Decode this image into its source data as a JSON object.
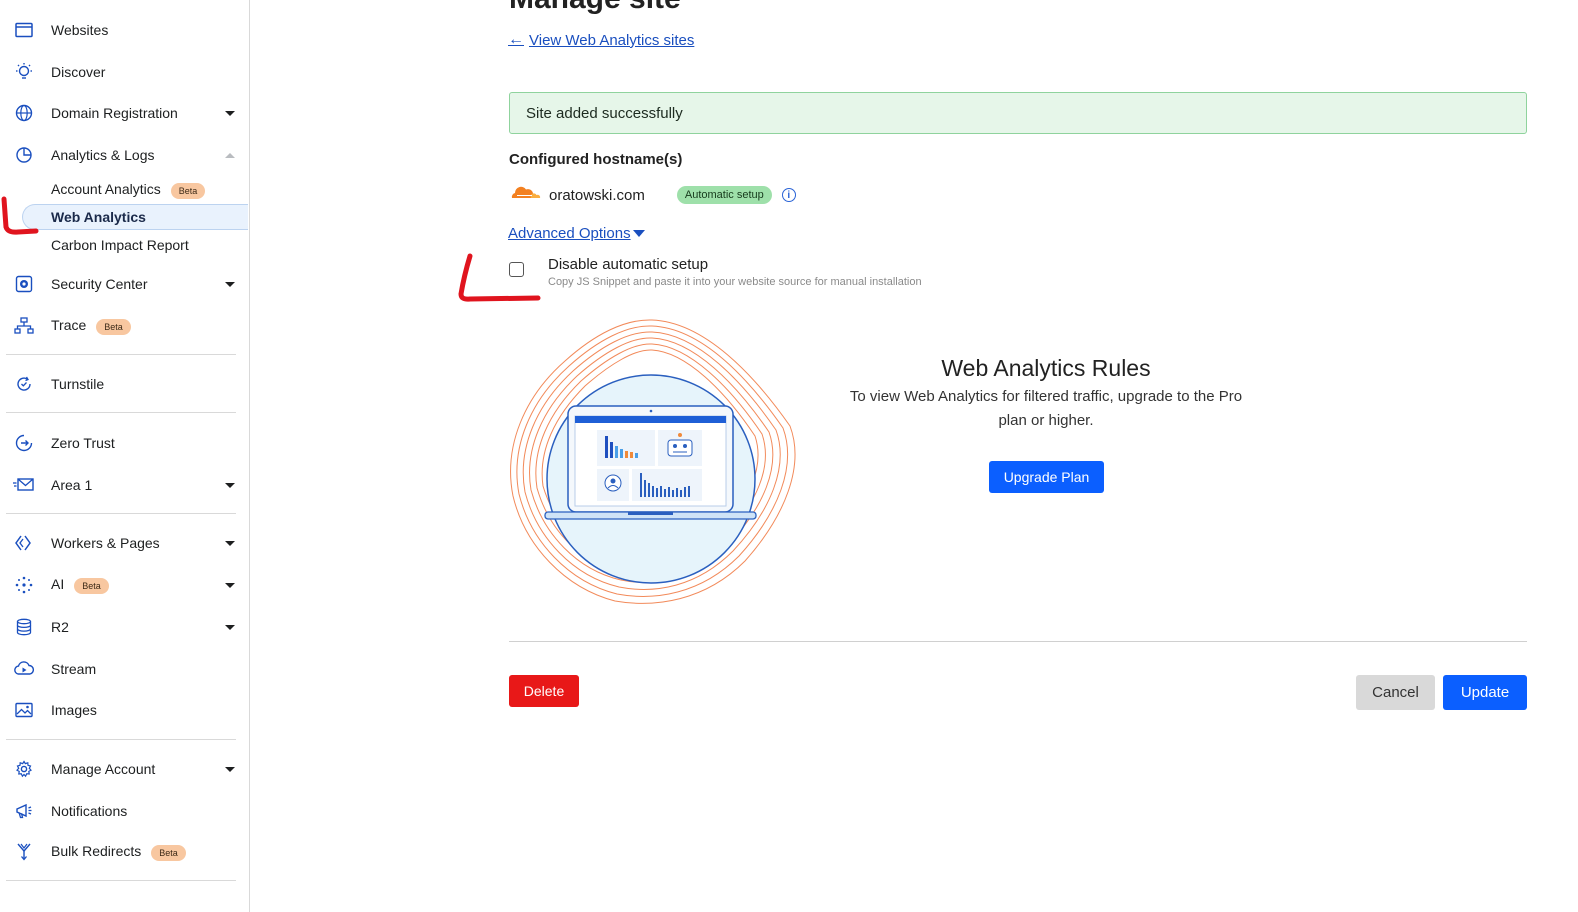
{
  "sidebar": {
    "websites": "Websites",
    "discover": "Discover",
    "domain_registration": "Domain Registration",
    "analytics_logs": "Analytics & Logs",
    "account_analytics": "Account Analytics",
    "web_analytics": "Web Analytics",
    "carbon_impact": "Carbon Impact Report",
    "security_center": "Security Center",
    "trace": "Trace",
    "turnstile": "Turnstile",
    "zero_trust": "Zero Trust",
    "area1": "Area 1",
    "workers_pages": "Workers & Pages",
    "ai": "AI",
    "r2": "R2",
    "stream": "Stream",
    "images": "Images",
    "manage_account": "Manage Account",
    "notifications": "Notifications",
    "bulk_redirects": "Bulk Redirects",
    "beta_label": "Beta"
  },
  "main": {
    "page_title": "Manage site",
    "back_link": "View Web Analytics sites",
    "success_message": "Site added successfully",
    "configured_title": "Configured hostname(s)",
    "hostname": "oratowski.com",
    "automatic_badge": "Automatic setup",
    "advanced_options": "Advanced Options",
    "disable_label": "Disable automatic setup",
    "disable_help": "Copy JS Snippet and paste it into your website source for manual installation",
    "disable_checked": false,
    "rules_title": "Web Analytics Rules",
    "rules_description": "To view Web Analytics for filtered traffic, upgrade to the Pro plan or higher.",
    "upgrade_button": "Upgrade Plan",
    "delete_button": "Delete",
    "cancel_button": "Cancel",
    "update_button": "Update"
  },
  "colors": {
    "primary": "#0b5fff",
    "danger": "#e81818",
    "success_bg": "#e6f6e9",
    "link": "#1a4fbf",
    "annotation": "#e0141e",
    "cloudflare_orange": "#f38020"
  }
}
